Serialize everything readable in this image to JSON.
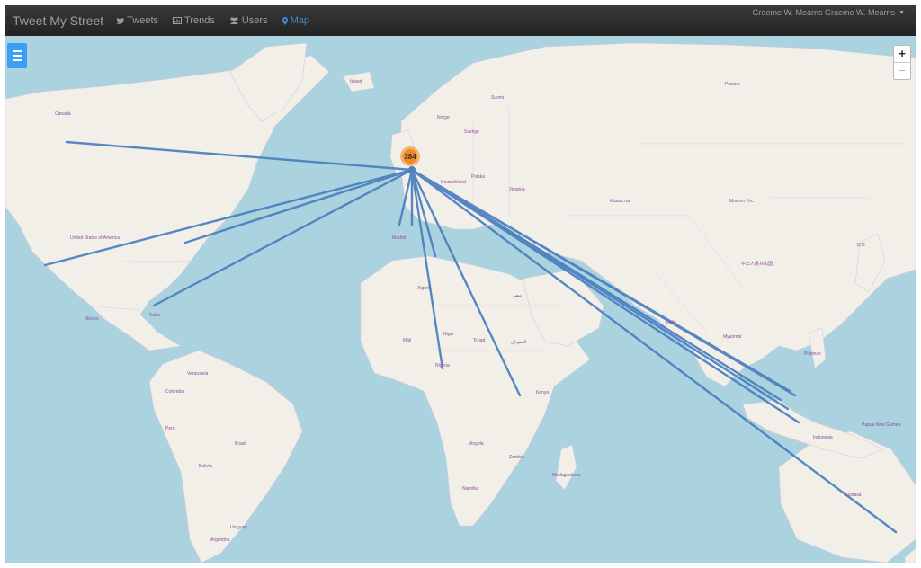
{
  "navbar": {
    "brand": "Tweet My Street",
    "items": [
      {
        "label": "Tweets",
        "icon": "twitter-icon",
        "active": false
      },
      {
        "label": "Trends",
        "icon": "chart-icon",
        "active": false
      },
      {
        "label": "Users",
        "icon": "users-icon",
        "active": false
      },
      {
        "label": "Map",
        "icon": "map-marker-icon",
        "active": true
      }
    ],
    "user_menu": "Graeme W. Mearns  Graeme W. Mearns"
  },
  "map": {
    "zoom_in": "+",
    "zoom_out": "−",
    "cluster_count": "384",
    "labels": {
      "canada": "Canada",
      "usa": "United States of America",
      "mexico": "México",
      "cuba": "Cuba",
      "venezuela": "Venezuela",
      "colombia": "Colombia",
      "peru": "Perú",
      "brasil": "Brasil",
      "bolivia": "Bolivia",
      "uruguay": "Uruguay",
      "argentina": "Argentina",
      "island": "Ísland",
      "norge": "Norge",
      "sverige": "Sverige",
      "suomi": "Suomi",
      "polska": "Polska",
      "deutschland": "Deutschland",
      "ukraine": "Україна",
      "madrid": "Madrid",
      "algerie": "Algérie",
      "mali": "Mali",
      "niger": "Niger",
      "tchad": "Tchad",
      "nigeria": "Nigeria",
      "soudan": "السودان",
      "egypt": "مصر",
      "kenya": "Kenya",
      "angola": "Angola",
      "zambia": "Zambia",
      "namibia": "Namibia",
      "madagasikara": "Madagasikara",
      "russia": "Россия",
      "kazakhstan": "Казахстан",
      "mongolia": "Монгол Улс",
      "china": "中华人民共和国",
      "india": "India",
      "myanmar": "Myanmar",
      "philippines": "Pilipinas",
      "indonesia": "Indonesia",
      "australia": "Australia",
      "png": "Papua New Guinea",
      "japan": "日本"
    }
  },
  "colors": {
    "water": "#aad3df",
    "land": "#f2efe9",
    "route": "#4a7fc0",
    "cluster": "#f0891e"
  }
}
